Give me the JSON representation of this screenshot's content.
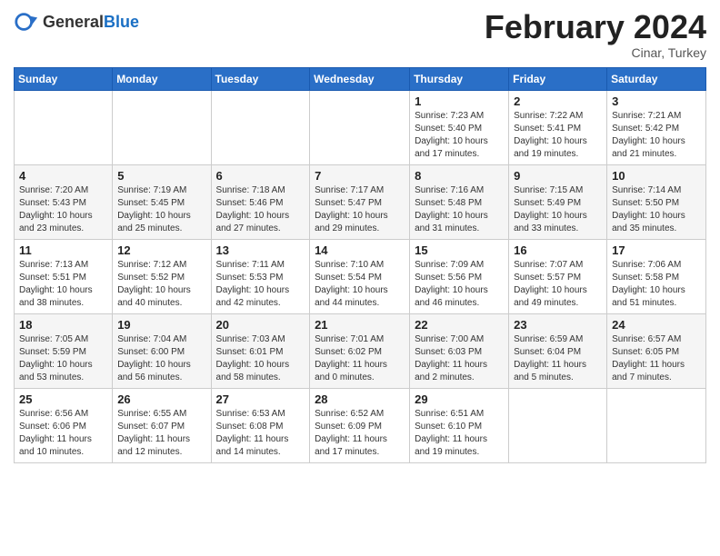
{
  "header": {
    "logo_general": "General",
    "logo_blue": "Blue",
    "month_year": "February 2024",
    "location": "Cinar, Turkey"
  },
  "weekdays": [
    "Sunday",
    "Monday",
    "Tuesday",
    "Wednesday",
    "Thursday",
    "Friday",
    "Saturday"
  ],
  "weeks": [
    [
      {
        "day": "",
        "info": ""
      },
      {
        "day": "",
        "info": ""
      },
      {
        "day": "",
        "info": ""
      },
      {
        "day": "",
        "info": ""
      },
      {
        "day": "1",
        "info": "Sunrise: 7:23 AM\nSunset: 5:40 PM\nDaylight: 10 hours\nand 17 minutes."
      },
      {
        "day": "2",
        "info": "Sunrise: 7:22 AM\nSunset: 5:41 PM\nDaylight: 10 hours\nand 19 minutes."
      },
      {
        "day": "3",
        "info": "Sunrise: 7:21 AM\nSunset: 5:42 PM\nDaylight: 10 hours\nand 21 minutes."
      }
    ],
    [
      {
        "day": "4",
        "info": "Sunrise: 7:20 AM\nSunset: 5:43 PM\nDaylight: 10 hours\nand 23 minutes."
      },
      {
        "day": "5",
        "info": "Sunrise: 7:19 AM\nSunset: 5:45 PM\nDaylight: 10 hours\nand 25 minutes."
      },
      {
        "day": "6",
        "info": "Sunrise: 7:18 AM\nSunset: 5:46 PM\nDaylight: 10 hours\nand 27 minutes."
      },
      {
        "day": "7",
        "info": "Sunrise: 7:17 AM\nSunset: 5:47 PM\nDaylight: 10 hours\nand 29 minutes."
      },
      {
        "day": "8",
        "info": "Sunrise: 7:16 AM\nSunset: 5:48 PM\nDaylight: 10 hours\nand 31 minutes."
      },
      {
        "day": "9",
        "info": "Sunrise: 7:15 AM\nSunset: 5:49 PM\nDaylight: 10 hours\nand 33 minutes."
      },
      {
        "day": "10",
        "info": "Sunrise: 7:14 AM\nSunset: 5:50 PM\nDaylight: 10 hours\nand 35 minutes."
      }
    ],
    [
      {
        "day": "11",
        "info": "Sunrise: 7:13 AM\nSunset: 5:51 PM\nDaylight: 10 hours\nand 38 minutes."
      },
      {
        "day": "12",
        "info": "Sunrise: 7:12 AM\nSunset: 5:52 PM\nDaylight: 10 hours\nand 40 minutes."
      },
      {
        "day": "13",
        "info": "Sunrise: 7:11 AM\nSunset: 5:53 PM\nDaylight: 10 hours\nand 42 minutes."
      },
      {
        "day": "14",
        "info": "Sunrise: 7:10 AM\nSunset: 5:54 PM\nDaylight: 10 hours\nand 44 minutes."
      },
      {
        "day": "15",
        "info": "Sunrise: 7:09 AM\nSunset: 5:56 PM\nDaylight: 10 hours\nand 46 minutes."
      },
      {
        "day": "16",
        "info": "Sunrise: 7:07 AM\nSunset: 5:57 PM\nDaylight: 10 hours\nand 49 minutes."
      },
      {
        "day": "17",
        "info": "Sunrise: 7:06 AM\nSunset: 5:58 PM\nDaylight: 10 hours\nand 51 minutes."
      }
    ],
    [
      {
        "day": "18",
        "info": "Sunrise: 7:05 AM\nSunset: 5:59 PM\nDaylight: 10 hours\nand 53 minutes."
      },
      {
        "day": "19",
        "info": "Sunrise: 7:04 AM\nSunset: 6:00 PM\nDaylight: 10 hours\nand 56 minutes."
      },
      {
        "day": "20",
        "info": "Sunrise: 7:03 AM\nSunset: 6:01 PM\nDaylight: 10 hours\nand 58 minutes."
      },
      {
        "day": "21",
        "info": "Sunrise: 7:01 AM\nSunset: 6:02 PM\nDaylight: 11 hours\nand 0 minutes."
      },
      {
        "day": "22",
        "info": "Sunrise: 7:00 AM\nSunset: 6:03 PM\nDaylight: 11 hours\nand 2 minutes."
      },
      {
        "day": "23",
        "info": "Sunrise: 6:59 AM\nSunset: 6:04 PM\nDaylight: 11 hours\nand 5 minutes."
      },
      {
        "day": "24",
        "info": "Sunrise: 6:57 AM\nSunset: 6:05 PM\nDaylight: 11 hours\nand 7 minutes."
      }
    ],
    [
      {
        "day": "25",
        "info": "Sunrise: 6:56 AM\nSunset: 6:06 PM\nDaylight: 11 hours\nand 10 minutes."
      },
      {
        "day": "26",
        "info": "Sunrise: 6:55 AM\nSunset: 6:07 PM\nDaylight: 11 hours\nand 12 minutes."
      },
      {
        "day": "27",
        "info": "Sunrise: 6:53 AM\nSunset: 6:08 PM\nDaylight: 11 hours\nand 14 minutes."
      },
      {
        "day": "28",
        "info": "Sunrise: 6:52 AM\nSunset: 6:09 PM\nDaylight: 11 hours\nand 17 minutes."
      },
      {
        "day": "29",
        "info": "Sunrise: 6:51 AM\nSunset: 6:10 PM\nDaylight: 11 hours\nand 19 minutes."
      },
      {
        "day": "",
        "info": ""
      },
      {
        "day": "",
        "info": ""
      }
    ]
  ]
}
